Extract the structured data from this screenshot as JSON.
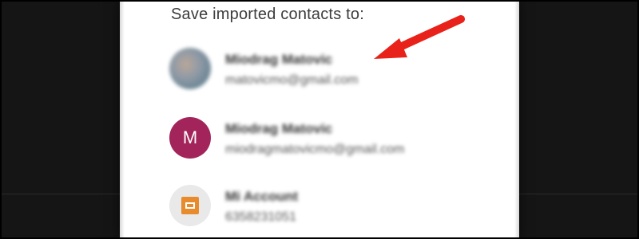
{
  "dialog": {
    "title": "Save imported contacts to:",
    "accounts": [
      {
        "name": "Miodrag Matovic",
        "email": "matovicmo@gmail.com",
        "avatar": "photo"
      },
      {
        "name": "Miodrag Matovic",
        "email": "miodragmatovicmo@gmail.com",
        "avatar": "letter",
        "avatar_letter": "M",
        "avatar_color": "#a3245a"
      },
      {
        "name": "Mi Account",
        "email": "6358231051",
        "avatar": "mi-logo",
        "avatar_color": "#e88b2d"
      }
    ]
  },
  "annotation": {
    "arrow_color": "#e8221a",
    "points_to": "first account name"
  }
}
